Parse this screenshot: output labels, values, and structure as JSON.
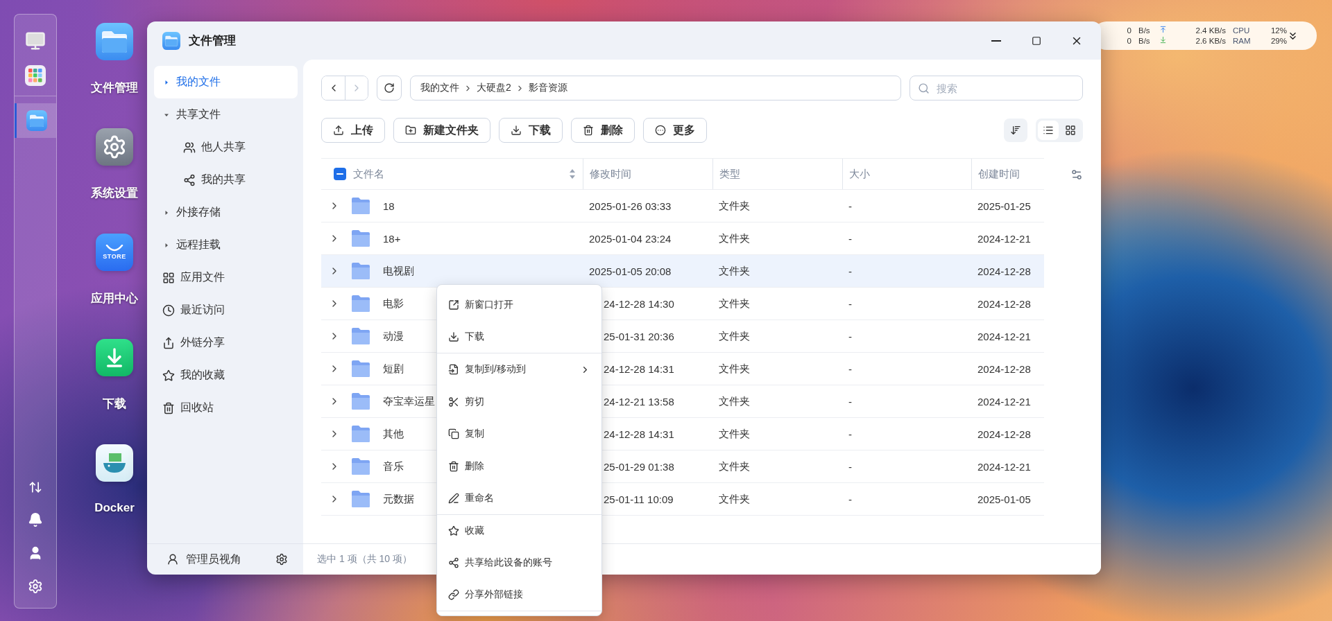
{
  "dock": {
    "running_apps": [
      {
        "active": true
      }
    ]
  },
  "desktop_icons": [
    {
      "label": "文件管理"
    },
    {
      "label": "系统设置"
    },
    {
      "label": "应用中心",
      "badge": "STORE"
    },
    {
      "label": "下载"
    },
    {
      "label": "Docker"
    }
  ],
  "monitor": {
    "rows": [
      {
        "rate": "0",
        "unit": "B/s",
        "kind": "upload",
        "speed": "2.4 KB/s",
        "metric": "CPU",
        "value": "12%"
      },
      {
        "rate": "0",
        "unit": "B/s",
        "kind": "download",
        "speed": "2.6 KB/s",
        "metric": "RAM",
        "value": "29%"
      }
    ]
  },
  "window": {
    "title": "文件管理"
  },
  "sidebar": {
    "items": [
      {
        "label": "我的文件",
        "kind": "tree",
        "expanded": false,
        "selected": true
      },
      {
        "label": "共享文件",
        "kind": "tree",
        "expanded": true,
        "selected": false,
        "children": [
          {
            "label": "他人共享",
            "selected": false
          },
          {
            "label": "我的共享",
            "selected": false
          }
        ]
      },
      {
        "label": "外接存储",
        "kind": "tree",
        "expanded": false,
        "selected": false
      },
      {
        "label": "远程挂载",
        "kind": "tree",
        "expanded": false,
        "selected": false
      },
      {
        "label": "应用文件",
        "kind": "link",
        "selected": false
      },
      {
        "label": "最近访问",
        "kind": "link",
        "selected": false
      },
      {
        "label": "外链分享",
        "kind": "link",
        "selected": false
      },
      {
        "label": "我的收藏",
        "kind": "link",
        "selected": false
      },
      {
        "label": "回收站",
        "kind": "link",
        "selected": false
      }
    ],
    "footer": {
      "label": "管理员视角"
    }
  },
  "nav": {
    "back_disabled": false,
    "forward_disabled": true
  },
  "breadcrumb": [
    "我的文件",
    "大硬盘2",
    "影音资源"
  ],
  "search": {
    "placeholder": "搜索"
  },
  "toolbar": [
    {
      "label": "上传"
    },
    {
      "label": "新建文件夹"
    },
    {
      "label": "下载"
    },
    {
      "label": "删除"
    },
    {
      "label": "更多"
    }
  ],
  "view_toggle": [
    {
      "kind": "list",
      "selected": true
    },
    {
      "kind": "grid",
      "selected": false
    }
  ],
  "table": {
    "select_all": {
      "checked": true,
      "partial": true
    },
    "columns": [
      {
        "label": "文件名",
        "sortable": true
      },
      {
        "label": "修改时间",
        "sortable": false
      },
      {
        "label": "类型",
        "sortable": false
      },
      {
        "label": "大小",
        "sortable": false
      },
      {
        "label": "创建时间",
        "sortable": false
      }
    ],
    "rows": [
      {
        "name": "18",
        "modified": "2025-01-26 03:33",
        "type": "文件夹",
        "size": "-",
        "created": "2025-01-25",
        "selected": false,
        "covered": false
      },
      {
        "name": "18+",
        "modified": "2025-01-04 23:24",
        "type": "文件夹",
        "size": "-",
        "created": "2024-12-21",
        "selected": false,
        "covered": false
      },
      {
        "name": "电视剧",
        "modified": "2025-01-05 20:08",
        "type": "文件夹",
        "size": "-",
        "created": "2024-12-28",
        "selected": true,
        "covered": false
      },
      {
        "name": "电影",
        "modified": "24-12-28 14:30",
        "type": "文件夹",
        "size": "-",
        "created": "2024-12-28",
        "selected": false,
        "covered": true
      },
      {
        "name": "动漫",
        "modified": "25-01-31 20:36",
        "type": "文件夹",
        "size": "-",
        "created": "2024-12-21",
        "selected": false,
        "covered": true
      },
      {
        "name": "短剧",
        "modified": "24-12-28 14:31",
        "type": "文件夹",
        "size": "-",
        "created": "2024-12-28",
        "selected": false,
        "covered": true
      },
      {
        "name": "夺宝幸运星",
        "modified": "24-12-21 13:58",
        "type": "文件夹",
        "size": "-",
        "created": "2024-12-21",
        "selected": false,
        "covered": true
      },
      {
        "name": "其他",
        "modified": "24-12-28 14:31",
        "type": "文件夹",
        "size": "-",
        "created": "2024-12-28",
        "selected": false,
        "covered": true
      },
      {
        "name": "音乐",
        "modified": "25-01-29 01:38",
        "type": "文件夹",
        "size": "-",
        "created": "2024-12-21",
        "selected": false,
        "covered": true
      },
      {
        "name": "元数据",
        "modified": "25-01-11 10:09",
        "type": "文件夹",
        "size": "-",
        "created": "2025-01-05",
        "selected": false,
        "covered": true
      }
    ]
  },
  "context_menu": {
    "items": [
      {
        "label": "新窗口打开",
        "submenu": false,
        "divider_after": false
      },
      {
        "label": "下载",
        "submenu": false,
        "divider_after": true
      },
      {
        "label": "复制到/移动到",
        "submenu": true,
        "divider_after": false
      },
      {
        "label": "剪切",
        "submenu": false,
        "divider_after": false
      },
      {
        "label": "复制",
        "submenu": false,
        "divider_after": false
      },
      {
        "label": "删除",
        "submenu": false,
        "divider_after": false
      },
      {
        "label": "重命名",
        "submenu": false,
        "divider_after": true
      },
      {
        "label": "收藏",
        "submenu": false,
        "divider_after": false
      },
      {
        "label": "共享给此设备的账号",
        "submenu": false,
        "divider_after": false
      },
      {
        "label": "分享外部链接",
        "submenu": false,
        "divider_after": true
      }
    ]
  },
  "status_bar": "选中 1 项（共 10 项）"
}
